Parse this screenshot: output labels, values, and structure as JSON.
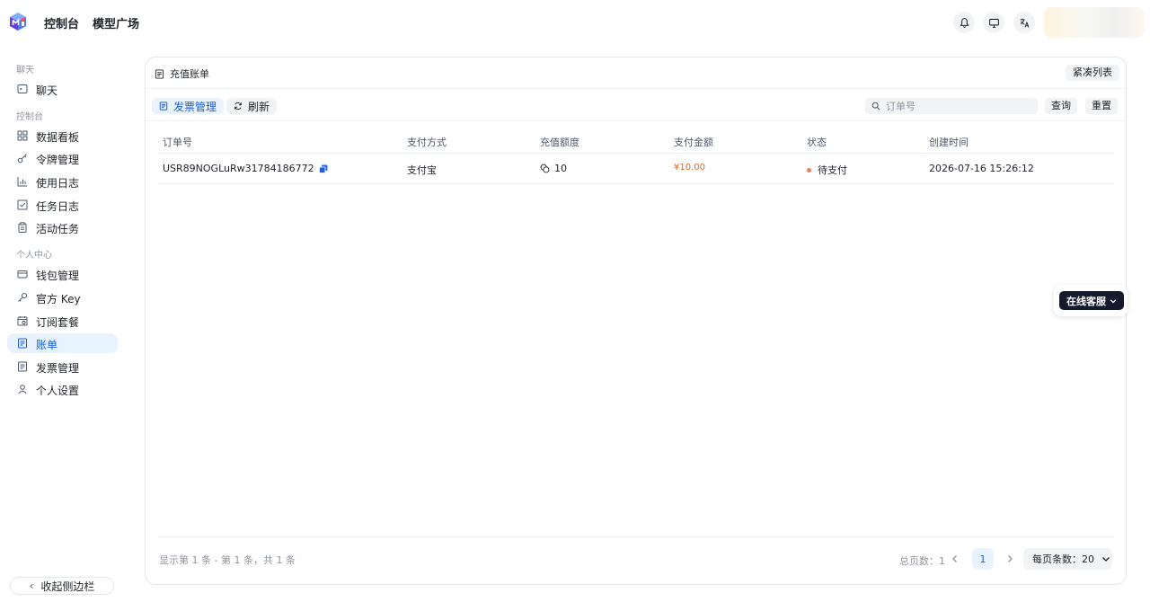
{
  "header": {
    "nav": {
      "console": "控制台",
      "models": "模型广场"
    }
  },
  "sidebar": {
    "sections": {
      "chat": "聊天",
      "console": "控制台",
      "personal": "个人中心"
    },
    "items": [
      {
        "label": "聊天",
        "icon": "chat-icon"
      },
      {
        "label": "数据看板",
        "icon": "dashboard-icon"
      },
      {
        "label": "令牌管理",
        "icon": "key-icon"
      },
      {
        "label": "使用日志",
        "icon": "bar-chart-icon"
      },
      {
        "label": "任务日志",
        "icon": "checkbox-icon"
      },
      {
        "label": "活动任务",
        "icon": "clipboard-icon"
      },
      {
        "label": "钱包管理",
        "icon": "wallet-icon"
      },
      {
        "label": "官方 Key",
        "icon": "wrench-key-icon"
      },
      {
        "label": "订阅套餐",
        "icon": "calendar-icon"
      },
      {
        "label": "账单",
        "icon": "bill-icon",
        "active": true
      },
      {
        "label": "发票管理",
        "icon": "invoice-icon"
      },
      {
        "label": "个人设置",
        "icon": "user-icon"
      }
    ],
    "collapse_label": "收起侧边栏"
  },
  "card": {
    "title": "充值账单",
    "compact_label": "紧凑列表",
    "invoice_btn": "发票管理",
    "refresh_btn": "刷新",
    "search_placeholder": "订单号",
    "query_btn": "查询",
    "reset_btn": "重置"
  },
  "table": {
    "columns": [
      "订单号",
      "支付方式",
      "充值额度",
      "支付金额",
      "状态",
      "创建时间"
    ],
    "rows": [
      {
        "order_id": "USR89NOGLuRw31784186772",
        "method": "支付宝",
        "quota": "10",
        "amount": "¥10.00",
        "status": "待支付",
        "created": "2026-07-16 15:26:12"
      }
    ]
  },
  "pagination": {
    "range_text": "显示第 1 条 - 第 1 条，共 1 条",
    "total_pages": "总页数：1",
    "current_page": "1",
    "page_size": "每页条数：20"
  },
  "support": {
    "label": "在线客服"
  },
  "colors": {
    "accent": "#1f5fd6",
    "active_bg": "#e8f3ff",
    "price": "#d4682c",
    "status_pending": "#e6805c",
    "support_bg": "#161a2d"
  }
}
